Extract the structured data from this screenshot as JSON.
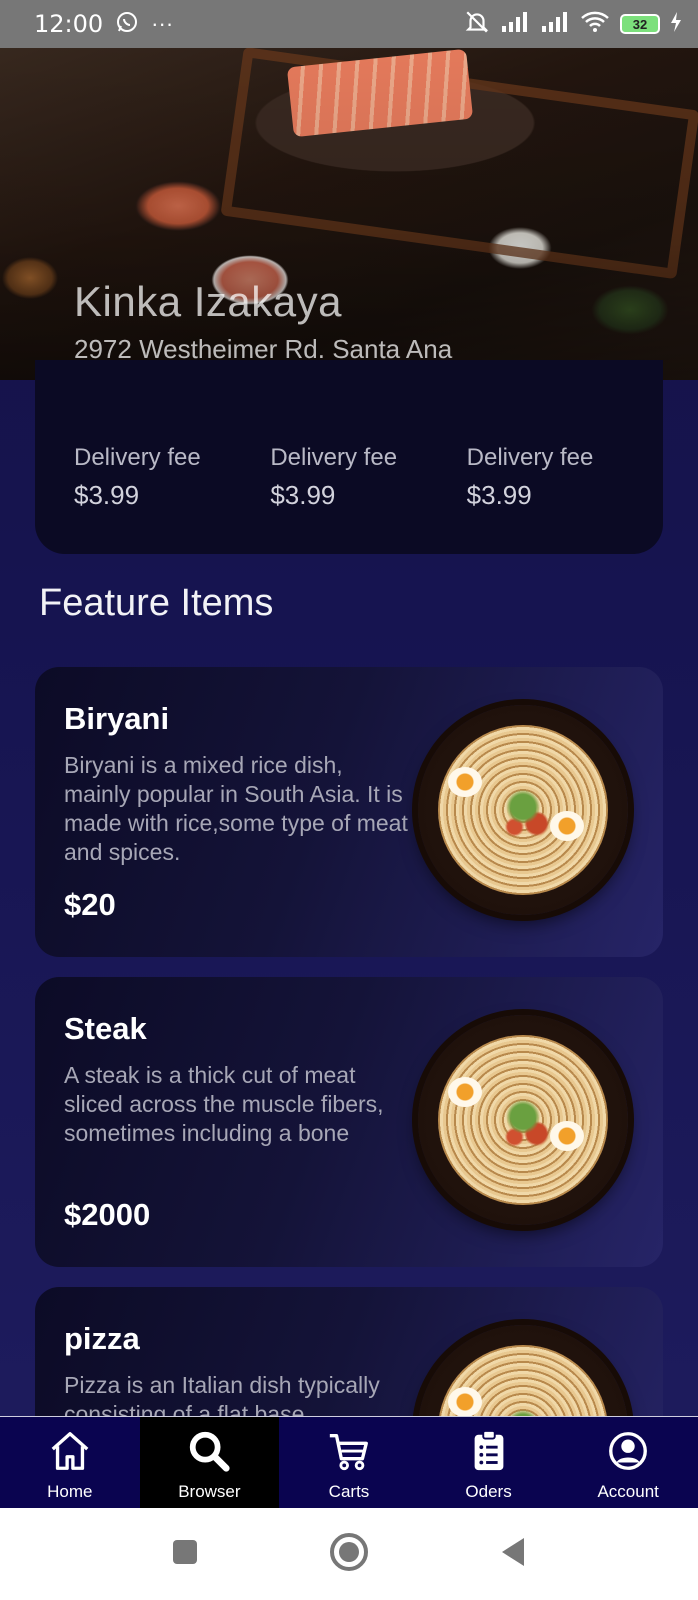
{
  "status_bar": {
    "time": "12:00",
    "dots": "···",
    "battery": "32"
  },
  "restaurant": {
    "name": "Kinka Izakaya",
    "address": "2972 Westheimer Rd. Santa Ana"
  },
  "info": [
    {
      "label": "Delivery fee",
      "value": "$3.99"
    },
    {
      "label": "Delivery fee",
      "value": "$3.99"
    },
    {
      "label": "Delivery fee",
      "value": "$3.99"
    }
  ],
  "section": {
    "title": "Feature Items"
  },
  "items": [
    {
      "name": "Biryani",
      "description": "Biryani is a mixed rice dish, mainly popular in South Asia. It is made with rice,some type of meat and spices.",
      "price": "$20"
    },
    {
      "name": "Steak",
      "description": "A steak is a thick cut of meat sliced across the muscle fibers, sometimes including a bone",
      "price": "$2000"
    },
    {
      "name": "pizza",
      "description": "Pizza is an Italian dish typically consisting of a flat base",
      "price": ""
    }
  ],
  "nav": {
    "home": "Home",
    "browser": "Browser",
    "carts": "Carts",
    "orders": "Oders",
    "account": "Account"
  },
  "colors": {
    "background": "#151245",
    "nav_background": "#0a0450",
    "nav_active": "#000000",
    "card_background": "#0b0a24"
  }
}
